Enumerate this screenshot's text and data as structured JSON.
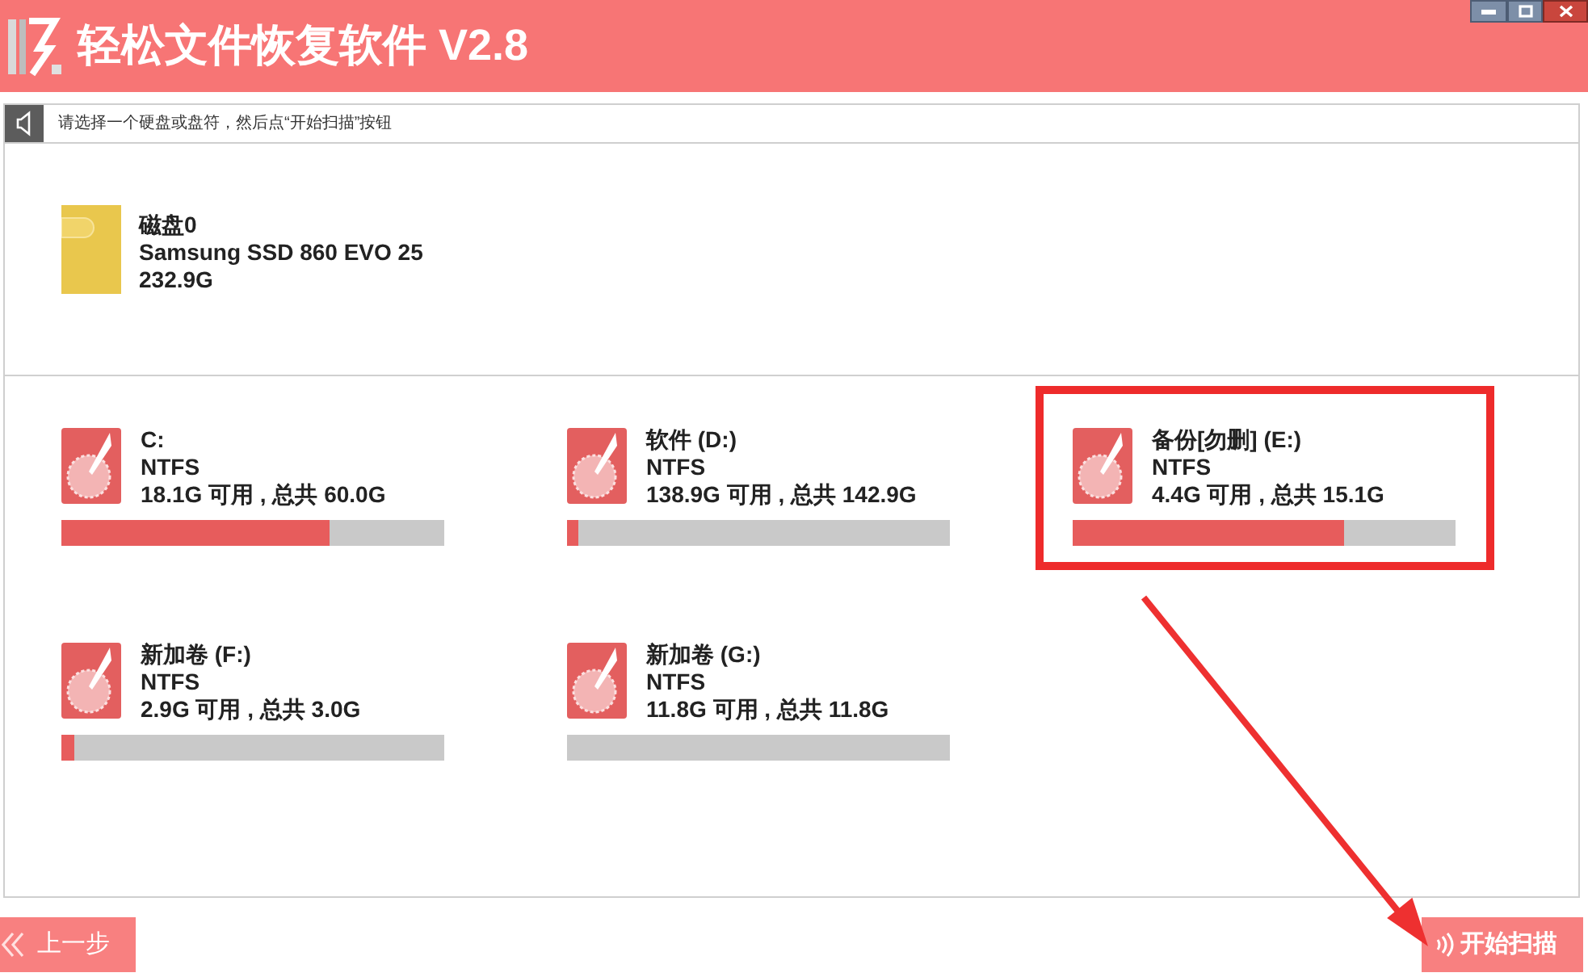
{
  "window": {
    "title": "轻松文件恢复软件 V2.8"
  },
  "hint": {
    "text": "请选择一个硬盘或盘符，然后点“开始扫描”按钮"
  },
  "disk": {
    "name": "磁盘0",
    "model": "Samsung SSD 860 EVO 25",
    "size": "232.9G"
  },
  "partitions": [
    {
      "name": "C:",
      "filesystem": "NTFS",
      "usage": "18.1G 可用 , 总共 60.0G",
      "level": 0.7,
      "highlighted": false
    },
    {
      "name": "软件 (D:)",
      "filesystem": "NTFS",
      "usage": "138.9G 可用 , 总共 142.9G",
      "level": 0.028,
      "highlighted": false
    },
    {
      "name": "备份[勿删] (E:)",
      "filesystem": "NTFS",
      "usage": "4.4G 可用 , 总共 15.1G",
      "level": 0.71,
      "highlighted": true
    },
    {
      "name": "新加卷 (F:)",
      "filesystem": "NTFS",
      "usage": "2.9G 可用 , 总共 3.0G",
      "level": 0.033,
      "highlighted": false
    },
    {
      "name": "新加卷 (G:)",
      "filesystem": "NTFS",
      "usage": "11.8G 可用 , 总共 11.8G",
      "highlighted": false
    }
  ],
  "buttons": [
    {
      "kind": "back",
      "label": "上一步"
    },
    {
      "kind": "scan",
      "label": "开始扫描"
    }
  ]
}
